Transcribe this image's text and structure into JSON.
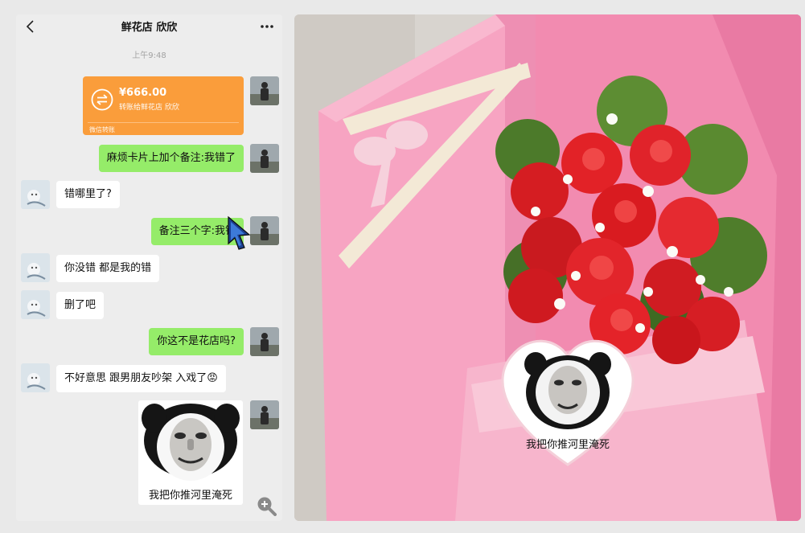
{
  "chat": {
    "title": "鲜花店 欣欣",
    "timestamp": "上午9:48",
    "transfer": {
      "amount": "¥666.00",
      "description": "转账给鲜花店 欣欣",
      "footer": "微信转账"
    },
    "messages": [
      {
        "sender": "me",
        "text": "麻烦卡片上加个备注:我错了"
      },
      {
        "sender": "them",
        "text": "错哪里了?"
      },
      {
        "sender": "me",
        "text": "备注三个字:我错"
      },
      {
        "sender": "them",
        "text": "你没错 都是我的错"
      },
      {
        "sender": "them",
        "text": "删了吧"
      },
      {
        "sender": "me",
        "text": "你这不是花店吗?"
      },
      {
        "sender": "them",
        "text": "不好意思 跟男朋友吵架 入戏了😡"
      }
    ],
    "sticker_caption": "我把你推河里淹死",
    "icons": {
      "back": "chevron-left-icon",
      "more": "more-dots-icon",
      "zoom": "zoom-in-icon"
    }
  },
  "photo": {
    "card_caption": "我把你推河里淹死"
  },
  "colors": {
    "my_bubble": "#95ec69",
    "their_bubble": "#ffffff",
    "transfer": "#fa9d3b",
    "chat_bg": "#ededed",
    "box_pink": "#f48db0"
  }
}
